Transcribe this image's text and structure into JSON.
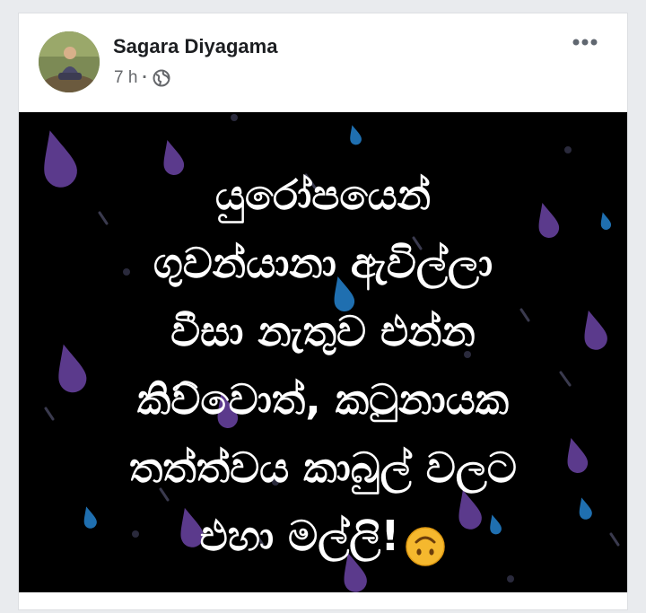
{
  "post": {
    "author": "Sagara Diyagama",
    "time": "7 h",
    "separator": "·",
    "privacy_icon": "globe-icon",
    "menu_icon": "more-options-icon",
    "image_text_lines": [
      "යුරෝපයෙන්",
      "ගුවන්යානා ඇවිල්ලා",
      "වීසා නැතුව එන්න",
      "කිව්වොත්, කටුනායක",
      "තත්ත්වය කාබුල් වලට",
      "එහා මල්ලි!"
    ],
    "emoji_icon": "upside-down-face-emoji",
    "colors": {
      "card_background": "#ffffff",
      "image_background": "#000000",
      "text": "#ffffff",
      "drop_purple": "#5b3a8c",
      "drop_blue": "#1f6fb0"
    }
  }
}
